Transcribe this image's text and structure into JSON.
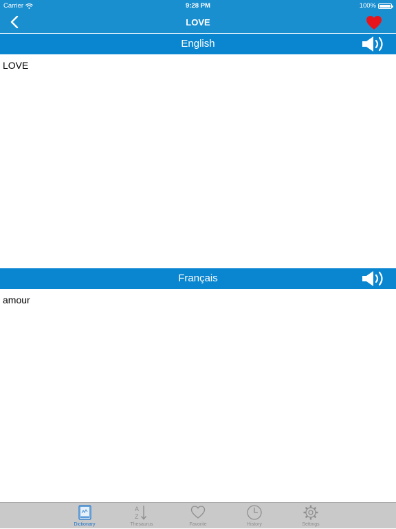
{
  "status_bar": {
    "carrier": "Carrier",
    "time": "9:28 PM",
    "battery": "100%"
  },
  "nav": {
    "title": "LOVE",
    "back_icon": "chevron-left-icon",
    "favorite_icon": "heart-icon"
  },
  "source": {
    "language": "English",
    "text": "LOVE"
  },
  "target": {
    "language": "Français",
    "text": "amour"
  },
  "tabs": [
    {
      "label": "Dictionary",
      "icon": "dictionary-icon",
      "active": true
    },
    {
      "label": "Thesaurus",
      "icon": "az-sort-icon",
      "active": false
    },
    {
      "label": "Favorite",
      "icon": "heart-outline-icon",
      "active": false
    },
    {
      "label": "History",
      "icon": "clock-icon",
      "active": false
    },
    {
      "label": "Settings",
      "icon": "gear-icon",
      "active": false
    }
  ],
  "colors": {
    "nav_bar": "#1a8fd0",
    "section_header": "#0a86d0",
    "favorite_heart": "#e8141b",
    "tab_active": "#1a73c8",
    "tab_inactive": "#8e8e8e",
    "tab_bar": "#c9c9c9"
  }
}
